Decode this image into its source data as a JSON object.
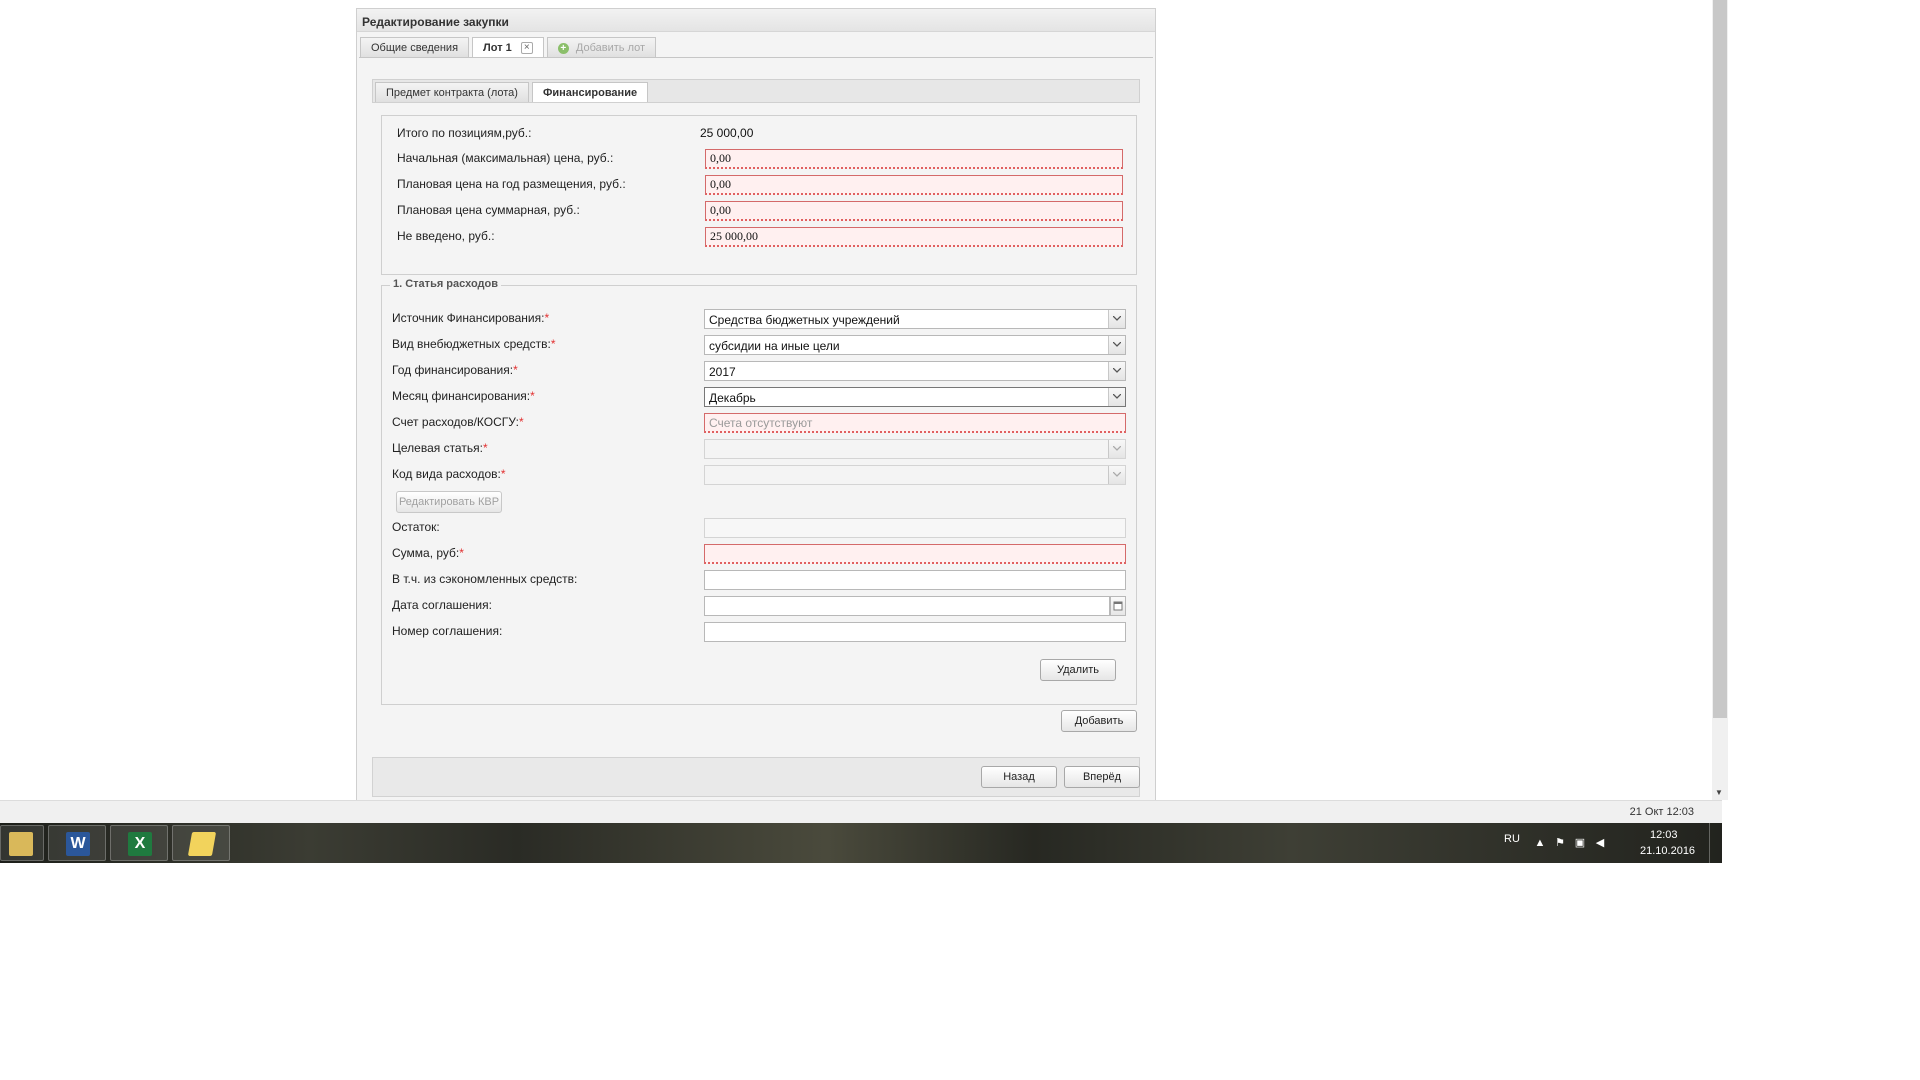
{
  "dialog": {
    "title": "Редактирование закупки",
    "outer_tabs": [
      {
        "label": "Общие сведения"
      },
      {
        "label": "Лот 1",
        "close": "×"
      },
      {
        "label": "Добавить лот"
      }
    ],
    "inner_tabs": [
      {
        "label": "Предмет контракта (лота)"
      },
      {
        "label": "Финансирование"
      }
    ]
  },
  "summary": {
    "total_label": "Итого по позициям,руб.:",
    "total_value": "25 000,00",
    "rows": [
      {
        "label": "Начальная (максимальная) цена, руб.:",
        "value": "0,00"
      },
      {
        "label": "Плановая цена на год размещения, руб.:",
        "value": "0,00"
      },
      {
        "label": "Плановая цена суммарная, руб.:",
        "value": "0,00"
      },
      {
        "label": "Не введено, руб.:",
        "value": "25 000,00"
      }
    ]
  },
  "expense": {
    "legend": "1. Статья расходов",
    "required_mark": "*",
    "source_label": "Источник Финансирования:",
    "source_value": "Средства бюджетных учреждений",
    "extra_type_label": "Вид внебюджетных средств:",
    "extra_type_value": "субсидии на иные цели",
    "year_label": "Год финансирования:",
    "year_value": "2017",
    "month_label": "Месяц финансирования:",
    "month_value": "Декабрь",
    "account_label": "Счет расходов/КОСГУ:",
    "account_placeholder": "Счета отсутствуют",
    "target_label": "Целевая статья:",
    "expense_code_label": "Код вида расходов:",
    "edit_kvr_button": "Редактировать КВР",
    "balance_label": "Остаток:",
    "sum_label": "Сумма, руб:",
    "saved_label": "В т.ч. из сэкономленных средств:",
    "agreement_date_label": "Дата соглашения:",
    "agreement_number_label": "Номер соглашения:",
    "delete_button": "Удалить"
  },
  "actions": {
    "add_button": "Добавить",
    "back_button": "Назад",
    "forward_button": "Вперёд"
  },
  "status_bar": {
    "datetime": "21 Окт 12:03"
  },
  "taskbar": {
    "apps": [
      {
        "name": "explorer",
        "glyph": ""
      },
      {
        "name": "word",
        "glyph": "W"
      },
      {
        "name": "excel",
        "glyph": "X"
      },
      {
        "name": "folder",
        "glyph": ""
      }
    ],
    "language": "RU",
    "time": "12:03",
    "date": "21.10.2016"
  },
  "colors": {
    "required": "#e23030",
    "invalid_bg": "#fff0f0",
    "invalid_border": "#d46a6a"
  }
}
